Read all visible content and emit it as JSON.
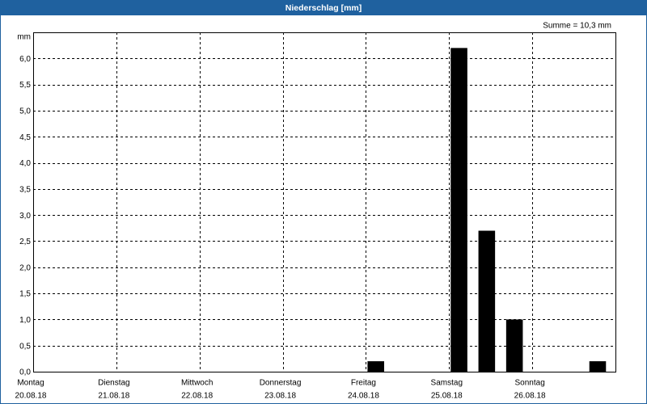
{
  "colors": {
    "title_bar": "#1f619f",
    "title_text": "#ffffff",
    "bars": "#000000",
    "grid": "#000000",
    "background": "#ffffff"
  },
  "chart_data": {
    "type": "bar",
    "title": "Niederschlag [mm]",
    "ylabel": "mm",
    "ylim": [
      0,
      6.5
    ],
    "grid": true,
    "annotation": "Summe = 10,3 mm",
    "y_ticks": [
      {
        "value": 0.0,
        "label": "0,0"
      },
      {
        "value": 0.5,
        "label": "0,5"
      },
      {
        "value": 1.0,
        "label": "1,0"
      },
      {
        "value": 1.5,
        "label": "1,5"
      },
      {
        "value": 2.0,
        "label": "2,0"
      },
      {
        "value": 2.5,
        "label": "2,5"
      },
      {
        "value": 3.0,
        "label": "3,0"
      },
      {
        "value": 3.5,
        "label": "3,5"
      },
      {
        "value": 4.0,
        "label": "4,0"
      },
      {
        "value": 4.5,
        "label": "4,5"
      },
      {
        "value": 5.0,
        "label": "5,0"
      },
      {
        "value": 5.5,
        "label": "5,5"
      },
      {
        "value": 6.0,
        "label": "6,0"
      }
    ],
    "days": [
      {
        "label": "Montag",
        "date": "20.08.18",
        "values": [
          0,
          0,
          0
        ]
      },
      {
        "label": "Dienstag",
        "date": "21.08.18",
        "values": [
          0,
          0,
          0
        ]
      },
      {
        "label": "Mittwoch",
        "date": "22.08.18",
        "values": [
          0,
          0,
          0
        ]
      },
      {
        "label": "Donnerstag",
        "date": "23.08.18",
        "values": [
          0,
          0,
          0
        ]
      },
      {
        "label": "Freitag",
        "date": "24.08.18",
        "values": [
          0.2,
          0,
          0
        ]
      },
      {
        "label": "Samstag",
        "date": "25.08.18",
        "values": [
          6.2,
          2.7,
          1.0
        ]
      },
      {
        "label": "Sonntag",
        "date": "26.08.18",
        "values": [
          0,
          0,
          0.2
        ]
      }
    ]
  }
}
